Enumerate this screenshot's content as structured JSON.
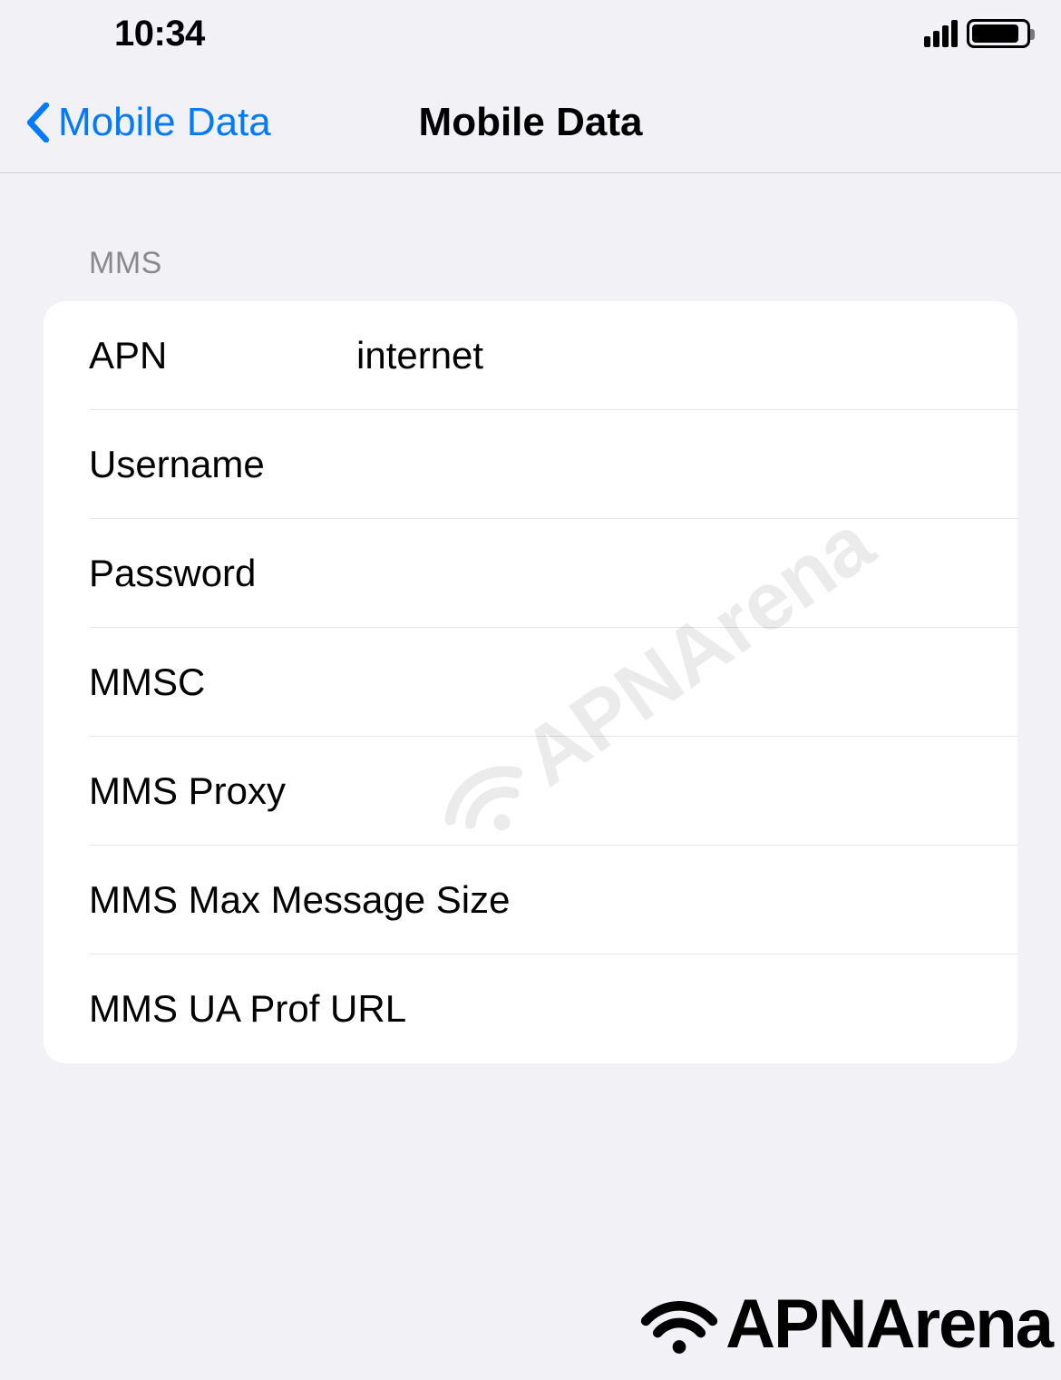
{
  "statusBar": {
    "time": "10:34"
  },
  "nav": {
    "backLabel": "Mobile Data",
    "title": "Mobile Data"
  },
  "section": {
    "header": "MMS",
    "rows": [
      {
        "label": "APN",
        "value": "internet"
      },
      {
        "label": "Username",
        "value": ""
      },
      {
        "label": "Password",
        "value": ""
      },
      {
        "label": "MMSC",
        "value": ""
      },
      {
        "label": "MMS Proxy",
        "value": ""
      },
      {
        "label": "MMS Max Message Size",
        "value": ""
      },
      {
        "label": "MMS UA Prof URL",
        "value": ""
      }
    ]
  },
  "watermark": {
    "text": "APNArena"
  }
}
